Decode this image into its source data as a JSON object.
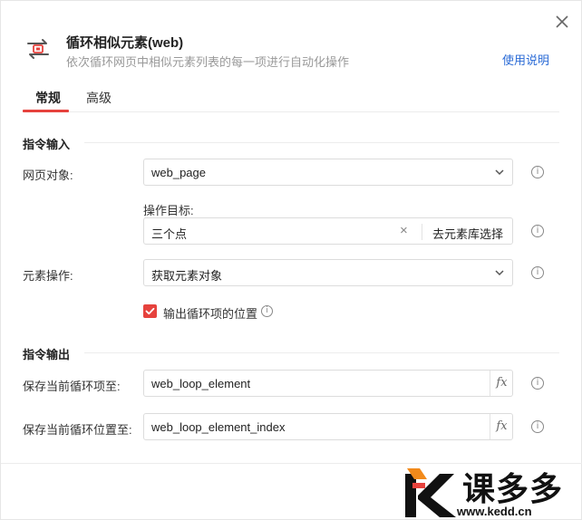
{
  "header": {
    "title": "循环相似元素(web)",
    "subtitle": "依次循环网页中相似元素列表的每一项进行自动化操作",
    "help_link": "使用说明",
    "icon": "loop-icon",
    "accent_color": "#e6423d"
  },
  "tabs": [
    {
      "label": "常规",
      "active": true
    },
    {
      "label": "高级",
      "active": false
    }
  ],
  "input_section": {
    "title": "指令输入",
    "webpage_label": "网页对象:",
    "webpage_value": "web_page",
    "target_label": "操作目标:",
    "target_value": "三个点",
    "target_clear": "×",
    "target_library_button": "去元素库选择",
    "element_op_label": "元素操作:",
    "element_op_value": "获取元素对象",
    "output_position_checkbox": {
      "label": "输出循环项的位置",
      "checked": true
    }
  },
  "output_section": {
    "title": "指令输出",
    "save_item_label": "保存当前循环项至:",
    "save_item_value": "web_loop_element",
    "save_index_label": "保存当前循环位置至:",
    "save_index_value": "web_loop_element_index",
    "fx_label": "fx"
  },
  "watermark": {
    "brand": "课多多",
    "url": "www.kedd.cn"
  }
}
